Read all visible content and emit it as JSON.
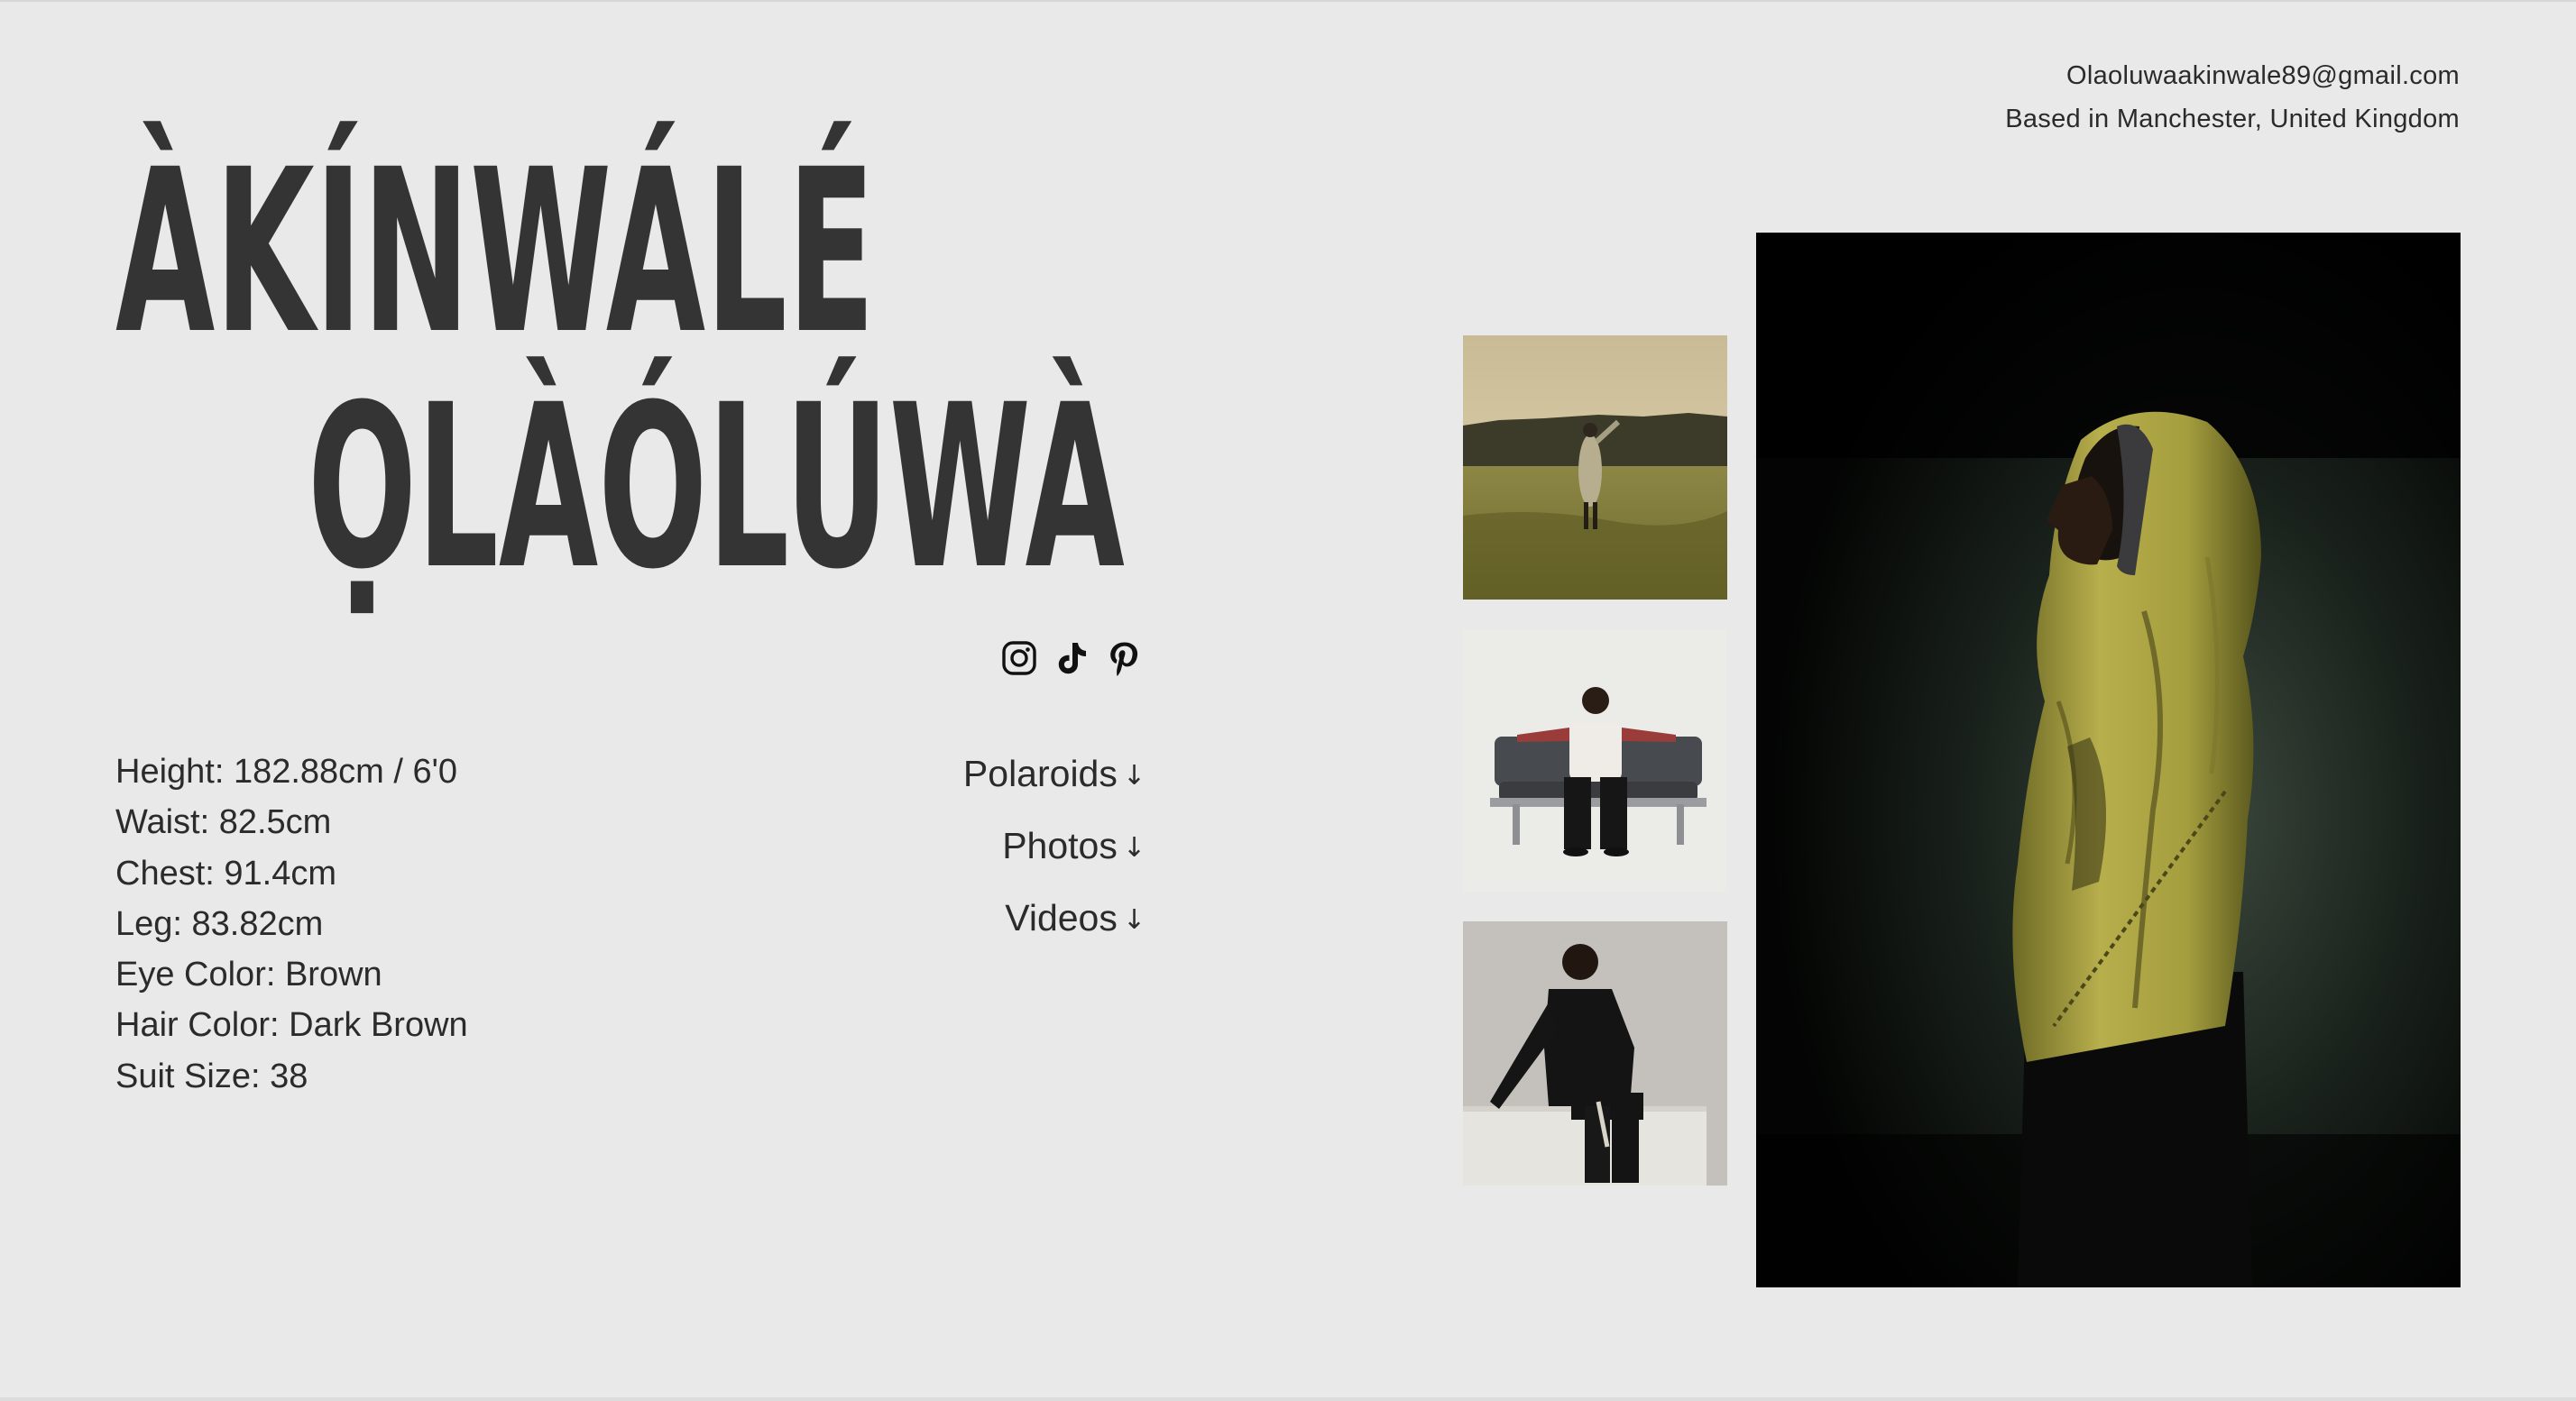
{
  "contact": {
    "email": "Olaoluwaakinwale89@gmail.com",
    "location": "Based in Manchester, United Kingdom"
  },
  "name": {
    "first": "ÀKÍNWÁLÉ",
    "second": "ỌLÀÓLÚWÀ"
  },
  "socials": [
    {
      "icon": "instagram-icon"
    },
    {
      "icon": "tiktok-icon"
    },
    {
      "icon": "pinterest-icon"
    }
  ],
  "stats": [
    "Height: 182.88cm / 6'0",
    "Waist: 82.5cm",
    "Chest: 91.4cm",
    "Leg: 83.82cm",
    "Eye Color: Brown",
    "Hair Color: Dark Brown",
    "Suit Size: 38"
  ],
  "nav": [
    {
      "label": "Polaroids",
      "arrow": "↓"
    },
    {
      "label": "Photos",
      "arrow": "↓"
    },
    {
      "label": "Videos",
      "arrow": "↓"
    }
  ],
  "colors": {
    "background": "#e9e9e9",
    "heading": "#343434",
    "text": "#2b2b2b",
    "jacket": "#b4ad4a"
  }
}
